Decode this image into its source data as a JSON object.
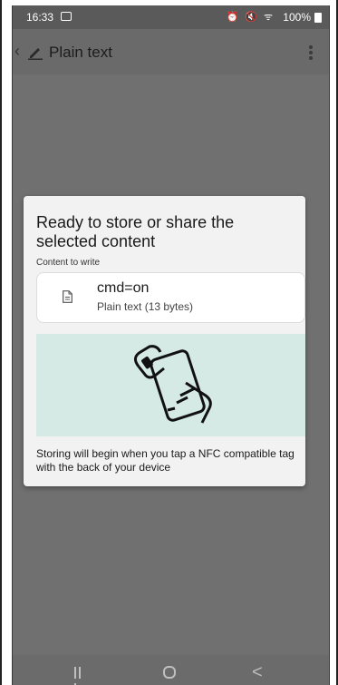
{
  "status_bar": {
    "time": "16:33",
    "icons": "⏰ 🔇 ᯤ",
    "battery_text": "100%"
  },
  "app_bar": {
    "title": "Plain text"
  },
  "dialog": {
    "title": "Ready to store or share the selected content",
    "subtitle": "Content to write",
    "content_value": "cmd=on",
    "content_type": "Plain text (13 bytes)",
    "footer": "Storing will begin when you tap a NFC compatible tag with the back of your device",
    "illustration_bg": "#d5e9e5"
  },
  "nav_bar": {
    "back_glyph": "<"
  },
  "colors": {
    "scrim": "#707070",
    "dialog_bg": "#f2f2f2"
  }
}
